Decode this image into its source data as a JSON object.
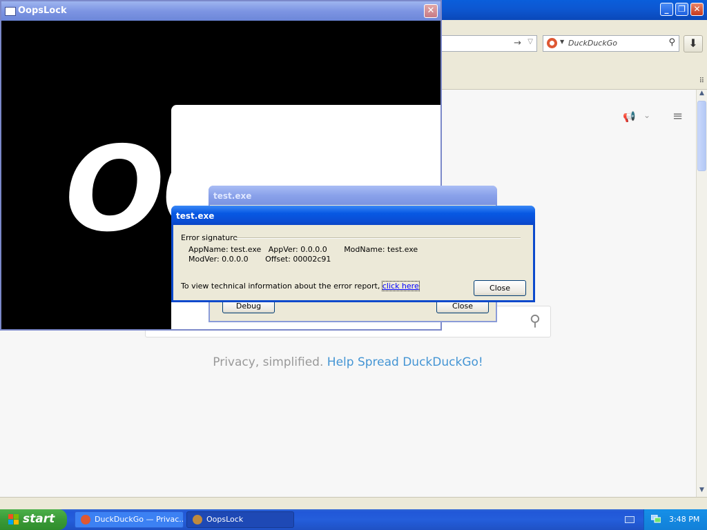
{
  "firefox": {
    "search_placeholder": "DuckDuckGo",
    "tagline_plain": "Privacy, simplified. ",
    "tagline_link": "Help Spread DuckDuckGo!"
  },
  "oopslock": {
    "title": "OopsLock",
    "big_text": "OO"
  },
  "dialog_back": {
    "title": "test.exe",
    "debug_label": "Debug",
    "close_label": "Close"
  },
  "dialog_front": {
    "title": "test.exe",
    "section_label": "Error signature",
    "line1": "AppName: test.exe   AppVer: 0.0.0.0       ModName: test.exe",
    "line2": "ModVer: 0.0.0.0       Offset: 00002c91",
    "tech_text": "To view technical information about the error report, ",
    "tech_link": "click here",
    "close_label": "Close"
  },
  "taskbar": {
    "start_label": "start",
    "tasks": [
      {
        "label": "DuckDuckGo — Privac..."
      },
      {
        "label": "OopsLock"
      }
    ],
    "clock": "3:48 PM"
  },
  "colors": {
    "xp_blue": "#0a5edb",
    "start_green": "#3a9a37",
    "ddg_link": "#4495d4",
    "ddg_orange": "#de5833"
  }
}
